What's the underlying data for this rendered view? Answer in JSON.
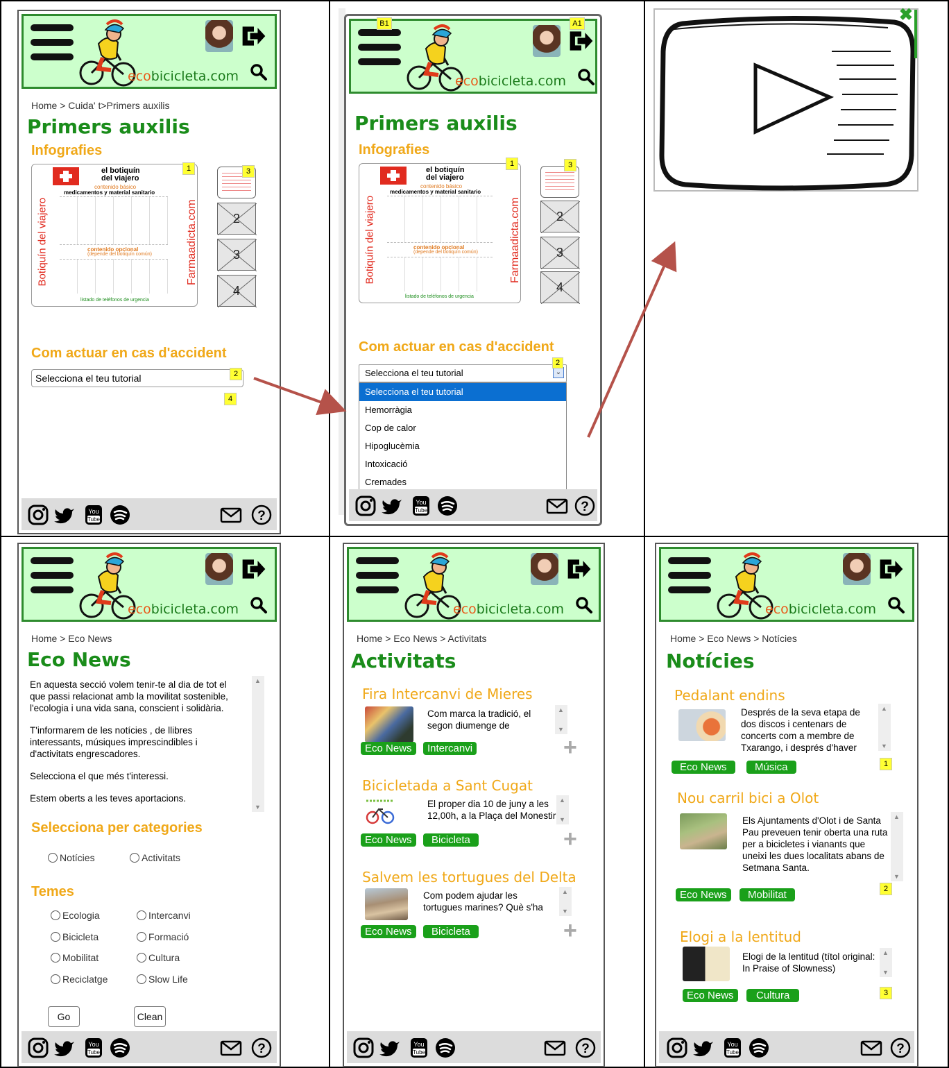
{
  "brand": {
    "site_eco": "eco",
    "site_rest": "bicicleta.com"
  },
  "footer": {
    "icons": [
      "instagram-icon",
      "twitter-icon",
      "youtube-icon",
      "spotify-icon",
      "mail-icon",
      "help-icon"
    ]
  },
  "first_aid": {
    "breadcrumb": "Home > Cuida' t>Primers auxilis",
    "title": "Primers auxilis",
    "infographics_heading": "Infografies",
    "infographic": {
      "title1": "el botiquín",
      "title2": "del viajero",
      "basic": "contenido básico",
      "materials": "medicamentos y material sanitario",
      "left": "Botiquín del viajero",
      "right": "Farmaadicta.com",
      "optional": "contenido opcional",
      "optional_sub": "(depende del botiquín común)",
      "phones": "listado de teléfonos de urgencia"
    },
    "thumbs": [
      "2",
      "3",
      "4"
    ],
    "accident_heading": "Com actuar en cas d'accident",
    "select_value": "Selecciona el teu tutorial",
    "options": [
      "Selecciona el teu tutorial",
      "Hemorràgia",
      "Cop de calor",
      "Hipoglucèmia",
      "Intoxicació",
      "Cremades"
    ],
    "badges": {
      "b1": "1",
      "b2": "2",
      "b3": "3",
      "b4": "4",
      "top_left": "B1",
      "top_right": "A1"
    }
  },
  "eco_news": {
    "breadcrumb": "Home > Eco News",
    "title": "Eco News",
    "intro_p1": "En aquesta secció volem tenir-te al dia de tot el que passi relacionat amb la movilitat sostenible, l'ecologia i una vida sana, conscient i solidària.",
    "intro_p2": "T'informarem de les notícies , de llibres interessants, músiques imprescindibles i d'activitats engrescadores.",
    "intro_p3": "Selecciona el que més t'interessi.",
    "intro_p4": "Estem oberts a les teves aportacions.",
    "categories_heading": "Selecciona per categories",
    "categories": [
      "Notícies",
      "Activitats"
    ],
    "topics_heading": "Temes",
    "topics": [
      "Ecologia",
      "Intercanvi",
      "Bicicleta",
      "Formació",
      "Mobilitat",
      "Cultura",
      "Reciclatge",
      "Slow Life"
    ],
    "go": "Go",
    "clean": "Clean"
  },
  "activities": {
    "breadcrumb": "Home > Eco News > Activitats",
    "title": "Activitats",
    "items": [
      {
        "title": "Fira  Intercanvi de Mieres",
        "text": "Com marca la tradició, el segon diumenge de",
        "tags": [
          "Eco News",
          "Intercanvi"
        ]
      },
      {
        "title": "Bicicletada a Sant Cugat",
        "text": "El proper dia 10 de juny a les 12,00h, a la Plaça del Monestir",
        "tags": [
          "Eco News",
          "Bicicleta"
        ]
      },
      {
        "title": "Salvem les tortugues del Delta",
        "text": "Com podem ajudar les tortugues marines? Què s'ha",
        "tags": [
          "Eco News",
          "Bicicleta"
        ]
      }
    ]
  },
  "news": {
    "breadcrumb": "Home > Eco News > Notícies",
    "title": "Notícies",
    "items": [
      {
        "title": "Pedalant endins",
        "text": "Després de la seva etapa de dos discos i centenars de concerts com a membre de Txarango, i després d'haver",
        "tags": [
          "Eco News",
          "Música"
        ],
        "badge": "1"
      },
      {
        "title": "Nou carril bici a Olot",
        "text": "Els Ajuntaments d'Olot i de Santa Pau preveuen tenir oberta una ruta per a bicicletes i vianants que uneixi les dues localitats abans de Setmana Santa.",
        "tags": [
          "Eco News",
          "Mobilitat"
        ],
        "badge": "2"
      },
      {
        "title": "Elogi a la lentitud",
        "text": "Elogi de la lentitud (títol original: In Praise of Slowness)",
        "tags": [
          "Eco News",
          "Cultura"
        ],
        "badge": "3"
      }
    ]
  },
  "colors": {
    "header_bg": "#ccffcc",
    "header_border": "#2e8b2e",
    "title_green": "#1a8c1a",
    "heading_orange": "#f0a818",
    "tag_green": "#1aa01a",
    "arrow": "#b5524a",
    "dropdown_highlight": "#0b6fd1"
  }
}
